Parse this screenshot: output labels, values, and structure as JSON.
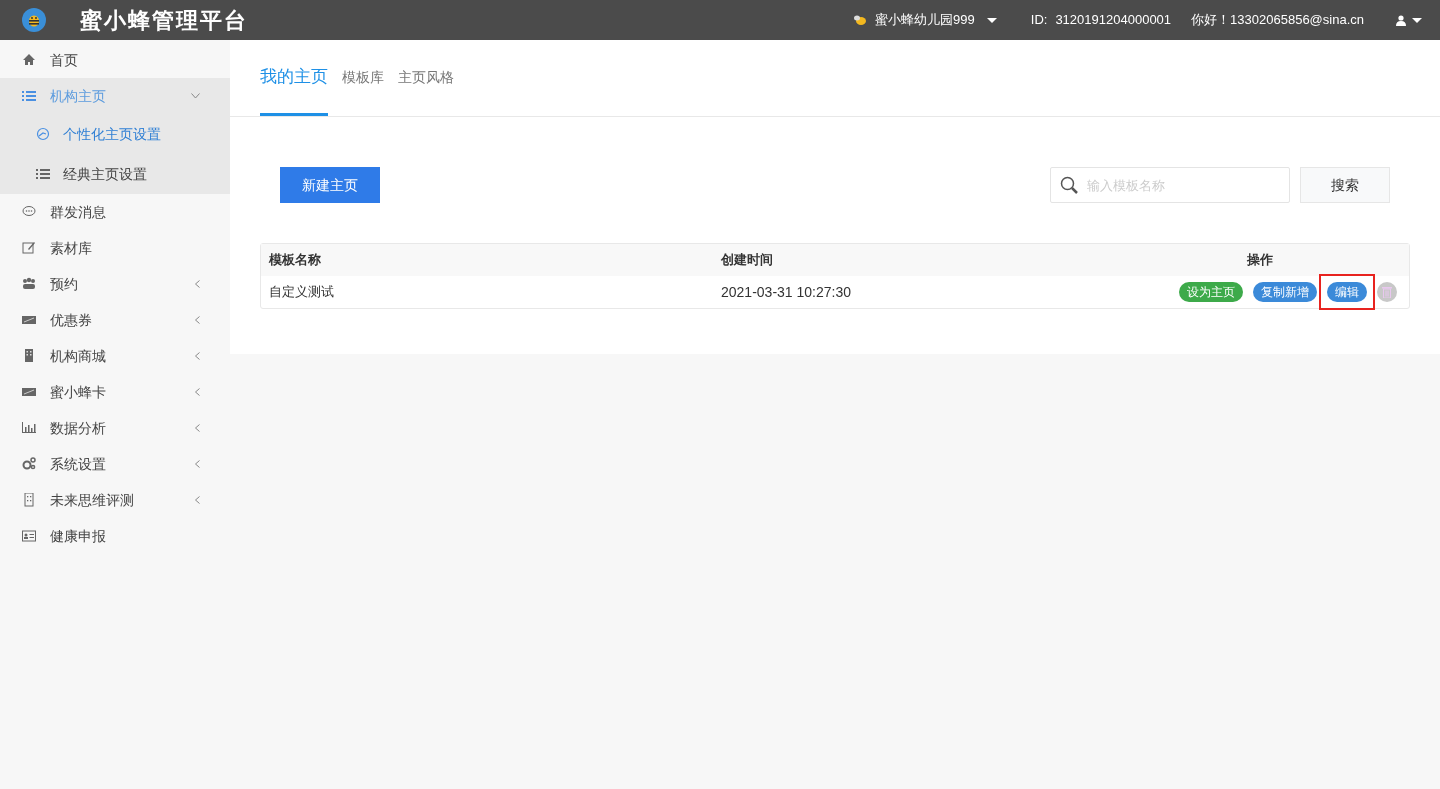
{
  "header": {
    "title": "蜜小蜂管理平台",
    "school": "蜜小蜂幼儿园999",
    "id_label": "ID:",
    "id_value": "3120191204000001",
    "greeting": "你好！13302065856@sina.cn"
  },
  "sidebar": {
    "items": [
      {
        "label": "首页",
        "selected": false
      },
      {
        "label": "机构主页",
        "selected": true,
        "expanded": true,
        "children": [
          {
            "label": "个性化主页设置",
            "selected": true
          },
          {
            "label": "经典主页设置",
            "selected": false
          }
        ]
      },
      {
        "label": "群发消息",
        "selected": false
      },
      {
        "label": "素材库",
        "selected": false
      },
      {
        "label": "预约",
        "selected": false,
        "expanded": false
      },
      {
        "label": "优惠券",
        "selected": false,
        "expanded": false
      },
      {
        "label": "机构商城",
        "selected": false,
        "expanded": false
      },
      {
        "label": "蜜小蜂卡",
        "selected": false,
        "expanded": false
      },
      {
        "label": "数据分析",
        "selected": false,
        "expanded": false
      },
      {
        "label": "系统设置",
        "selected": false,
        "expanded": false
      },
      {
        "label": "未来思维评测",
        "selected": false,
        "expanded": false
      },
      {
        "label": "健康申报",
        "selected": false
      }
    ]
  },
  "tabs": [
    {
      "label": "我的主页",
      "selected": true
    },
    {
      "label": "模板库",
      "selected": false
    },
    {
      "label": "主页风格",
      "selected": false
    }
  ],
  "new_button": "新建主页",
  "search": {
    "placeholder": "输入模板名称",
    "button": "搜索"
  },
  "table": {
    "columns": [
      "模板名称",
      "创建时间",
      "操作"
    ],
    "rows": [
      {
        "name": "自定义测试",
        "created": "2021-03-31 10:27:30",
        "actions": [
          {
            "kind": "success",
            "label": "设为主页",
            "highlighted": false
          },
          {
            "kind": "primary",
            "label": "复制新增",
            "highlighted": false
          },
          {
            "kind": "primary",
            "label": "编辑",
            "highlighted": true
          },
          {
            "kind": "delete",
            "highlighted": false
          }
        ]
      }
    ]
  }
}
